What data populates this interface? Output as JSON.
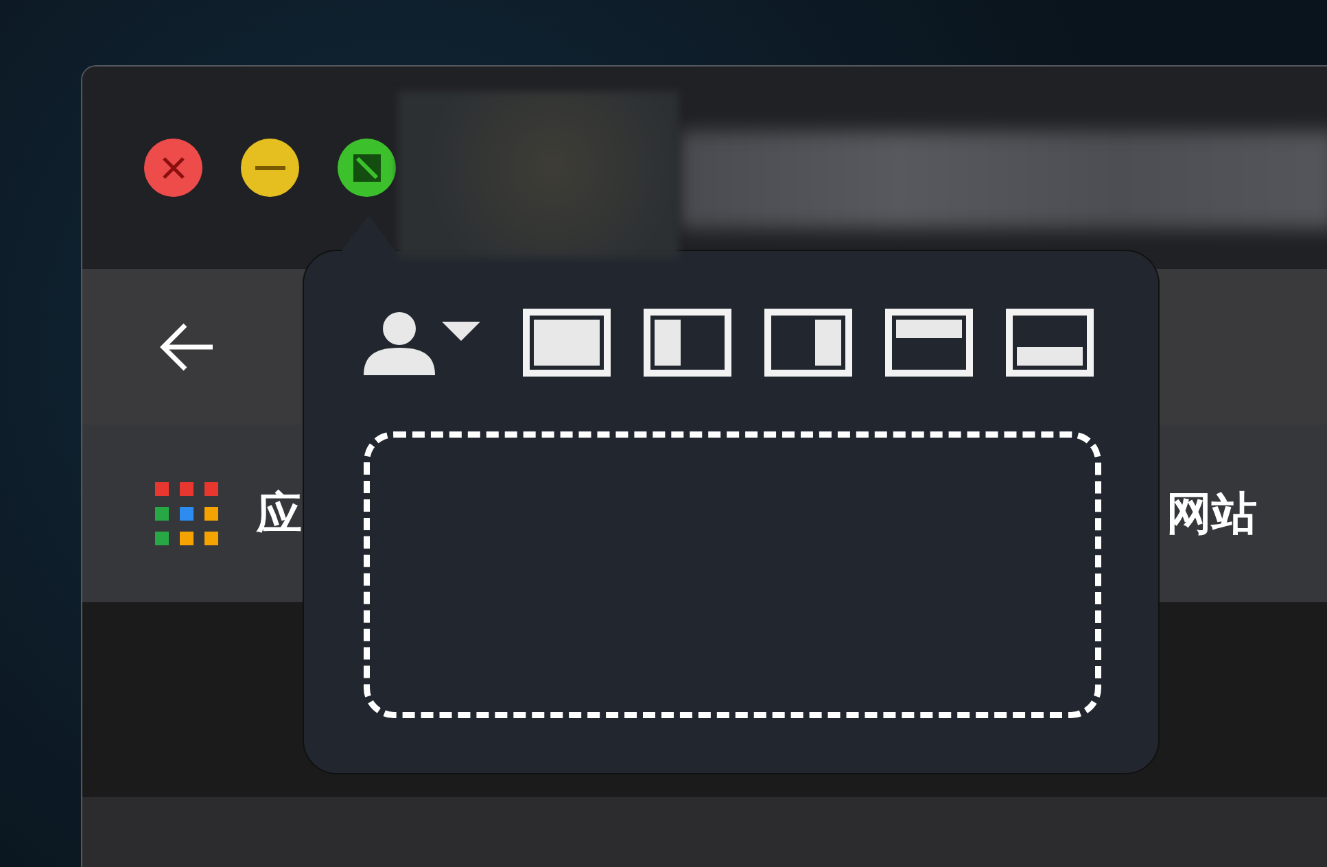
{
  "window": {
    "traffic_lights": [
      {
        "kind": "close",
        "color": "#ee4b4b"
      },
      {
        "kind": "minimize",
        "color": "#e5be1f"
      },
      {
        "kind": "zoom",
        "color": "#3cc12d"
      }
    ]
  },
  "bookmarks_bar": {
    "items": [
      {
        "kind": "apps",
        "label": "应"
      },
      {
        "kind": "link",
        "label": "网站"
      }
    ]
  },
  "popover": {
    "layouts": [
      {
        "kind": "full"
      },
      {
        "kind": "left"
      },
      {
        "kind": "right"
      },
      {
        "kind": "top"
      },
      {
        "kind": "bottom"
      }
    ]
  }
}
